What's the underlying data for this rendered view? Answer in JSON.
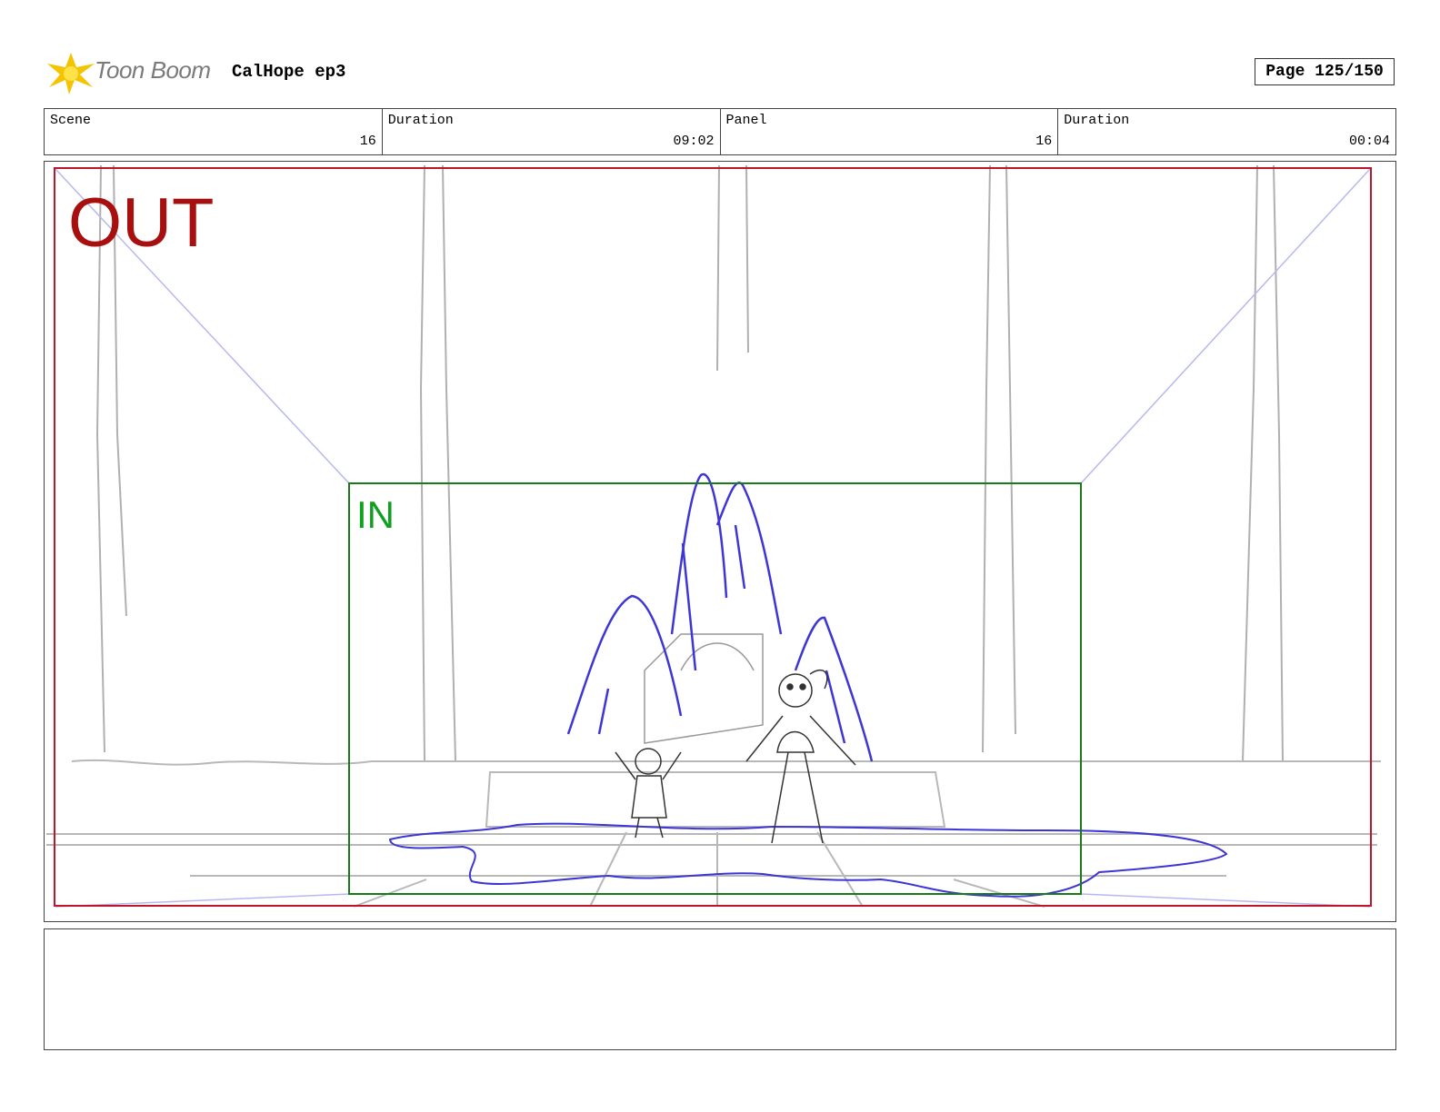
{
  "header": {
    "logo_text": "Toon Boom",
    "project_title": "CalHope ep3",
    "page_label": "Page 125/150"
  },
  "info": [
    {
      "label": "Scene",
      "value": "16"
    },
    {
      "label": "Duration",
      "value": "09:02"
    },
    {
      "label": "Panel",
      "value": "16"
    },
    {
      "label": "Duration",
      "value": "00:04"
    }
  ],
  "panel": {
    "out_label": "OUT",
    "in_label": "IN",
    "colors": {
      "out_frame": "#c0142a",
      "in_frame": "#1a7a1a",
      "sketch_blue": "#3d35d6",
      "sketch_gray": "#b0b0b0",
      "guide_lines": "#b8b8f0"
    }
  },
  "notes": {
    "text": ""
  }
}
